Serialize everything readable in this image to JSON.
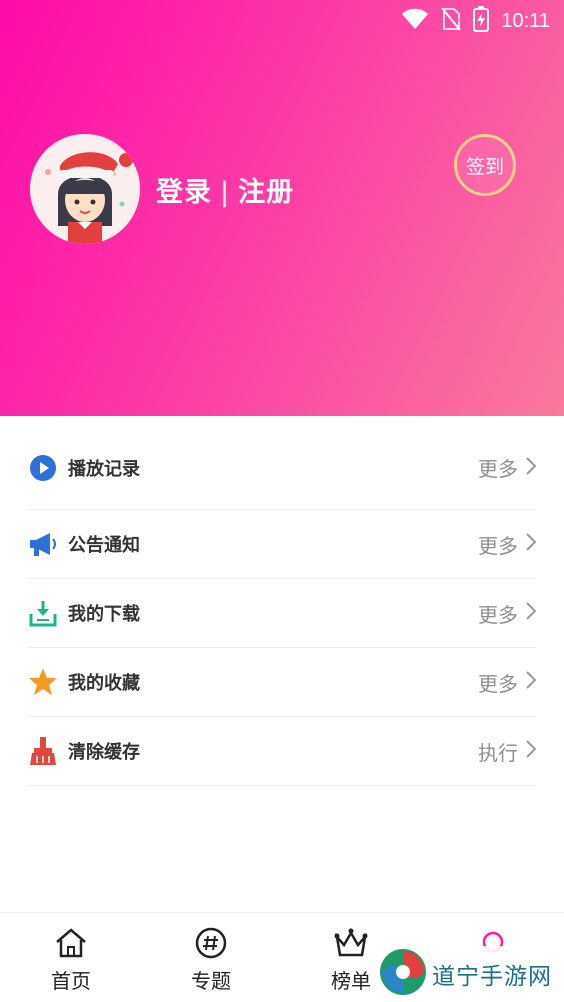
{
  "status_bar": {
    "time": "10:11"
  },
  "profile": {
    "login_label": "登录",
    "separator": "|",
    "register_label": "注册",
    "signin_label": "签到"
  },
  "menu": {
    "items": [
      {
        "label": "播放记录",
        "action": "更多",
        "icon": "play-icon",
        "color": "#2f6fd8"
      },
      {
        "label": "公告通知",
        "action": "更多",
        "icon": "megaphone-icon",
        "color": "#2f6fd8"
      },
      {
        "label": "我的下载",
        "action": "更多",
        "icon": "download-icon",
        "color": "#19b68f"
      },
      {
        "label": "我的收藏",
        "action": "更多",
        "icon": "star-icon",
        "color": "#f49a25"
      },
      {
        "label": "清除缓存",
        "action": "执行",
        "icon": "broom-icon",
        "color": "#e0483f"
      }
    ]
  },
  "tabbar": {
    "tabs": [
      {
        "label": "首页",
        "icon": "home-icon"
      },
      {
        "label": "专题",
        "icon": "hashtag-icon"
      },
      {
        "label": "榜单",
        "icon": "crown-icon"
      },
      {
        "label": "",
        "icon": "profile-icon"
      }
    ]
  },
  "watermark": {
    "text": "道宁手游网"
  },
  "colors": {
    "header_start": "#ff0aa8",
    "header_end": "#f87a9c",
    "signin_border": "#f1d08a"
  }
}
